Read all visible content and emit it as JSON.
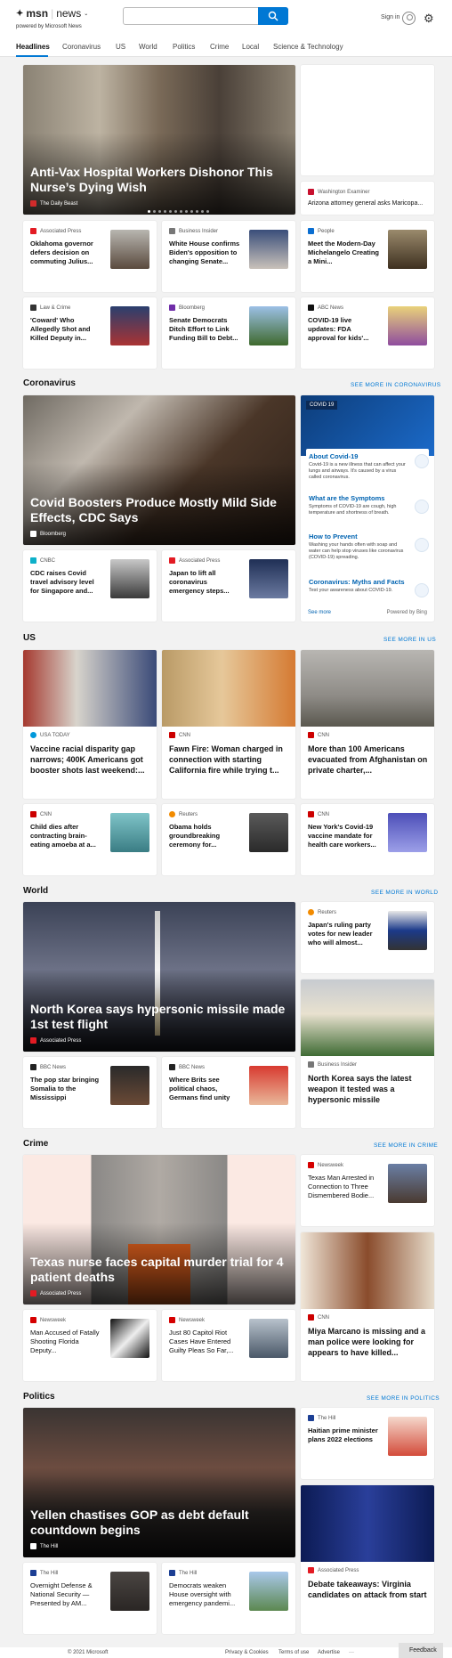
{
  "header": {
    "brand": "msn",
    "product": "news",
    "powered_by": "powered by Microsoft News",
    "search_placeholder": "",
    "sign_in": "Sign in"
  },
  "nav": [
    "Headlines",
    "Coronavirus",
    "US",
    "World",
    "Politics",
    "Crime",
    "Local",
    "Science & Technology"
  ],
  "headlines": {
    "hero": {
      "title": "Anti-Vax Hospital Workers Dishonor This Nurse’s Dying Wish",
      "source": "The Daily Beast"
    },
    "side": {
      "source": "Washington Examiner",
      "title": "Arizona attorney general asks Maricopa..."
    },
    "row1": [
      {
        "source": "Associated Press",
        "title": "Oklahoma governor defers decision on commuting Julius..."
      },
      {
        "source": "Business Insider",
        "title": "White House confirms Biden's opposition to changing Senate..."
      },
      {
        "source": "People",
        "title": "Meet the Modern-Day Michelangelo Creating a Mini..."
      }
    ],
    "row2": [
      {
        "source": "Law & Crime",
        "title": "'Coward' Who Allegedly Shot and Killed Deputy in..."
      },
      {
        "source": "Bloomberg",
        "title": "Senate Democrats Ditch Effort to Link Funding Bill to Debt..."
      },
      {
        "source": "ABC News",
        "title": "COVID-19 live updates: FDA approval for kids'..."
      }
    ]
  },
  "coronavirus": {
    "heading": "Coronavirus",
    "more": "SEE MORE IN CORONAVIRUS",
    "hero": {
      "title": "Covid Boosters Produce Mostly Mild Side Effects, CDC Says",
      "source": "Bloomberg"
    },
    "row": [
      {
        "source": "CNBC",
        "title": "CDC raises Covid travel advisory level for Singapore and..."
      },
      {
        "source": "Associated Press",
        "title": "Japan to lift all coronavirus emergency steps..."
      }
    ],
    "panel": {
      "tag": "COVID 19",
      "items": [
        {
          "h": "About Covid-19",
          "d": "Covid-19 is a new illness that can affect your lungs and airways. It's caused by a virus called coronavirus."
        },
        {
          "h": "What are the Symptoms",
          "d": "Symptoms of COVID-19 are cough, high temperature and shortness of breath."
        },
        {
          "h": "How to Prevent",
          "d": "Washing your hands often with soap and water can help stop viruses like coronavirus (COVID-19) spreading."
        },
        {
          "h": "Coronavirus: Myths and Facts",
          "d": "Test your awareness about COVID-19."
        }
      ],
      "see_more": "See more",
      "powered": "Powered by Bing"
    }
  },
  "us": {
    "heading": "US",
    "more": "SEE MORE IN US",
    "top": [
      {
        "source": "USA TODAY",
        "title": "Vaccine racial disparity gap narrows; 400K Americans got booster shots last weekend:..."
      },
      {
        "source": "CNN",
        "title": "Fawn Fire: Woman charged in connection with starting California fire while trying t..."
      },
      {
        "source": "CNN",
        "title": "More than 100 Americans evacuated from Afghanistan on private charter,..."
      }
    ],
    "row": [
      {
        "source": "CNN",
        "title": "Child dies after contracting brain-eating amoeba at a..."
      },
      {
        "source": "Reuters",
        "title": "Obama holds groundbreaking ceremony for..."
      },
      {
        "source": "CNN",
        "title": "New York's Covid-19 vaccine mandate for health care workers..."
      }
    ]
  },
  "world": {
    "heading": "World",
    "more": "SEE MORE IN WORLD",
    "hero": {
      "title": "North Korea says hypersonic missile made 1st test flight",
      "source": "Associated Press"
    },
    "side": {
      "source": "Reuters",
      "title": "Japan's ruling party votes for new leader who will almost..."
    },
    "row": [
      {
        "source": "BBC News",
        "title": "The pop star bringing Somalia to the Mississippi"
      },
      {
        "source": "BBC News",
        "title": "Where Brits see political chaos, Germans find unity"
      }
    ],
    "tall": {
      "source": "Business Insider",
      "title": "North Korea says the latest weapon it tested was a hypersonic missile"
    }
  },
  "crime": {
    "heading": "Crime",
    "more": "SEE MORE IN CRIME",
    "hero": {
      "title": "Texas nurse faces capital murder trial for 4 patient deaths",
      "source": "Associated Press"
    },
    "side": {
      "source": "Newsweek",
      "title": "Texas Man Arrested in Connection to Three Dismembered Bodie..."
    },
    "row": [
      {
        "source": "Newsweek",
        "title": "Man Accused of Fatally Shooting Florida Deputy..."
      },
      {
        "source": "Newsweek",
        "title": "Just 80 Capitol Riot Cases Have Entered Guilty Pleas So Far,..."
      }
    ],
    "tall": {
      "source": "CNN",
      "title": "Miya Marcano is missing and a man police were looking for appears to have killed..."
    }
  },
  "politics": {
    "heading": "Politics",
    "more": "SEE MORE IN POLITICS",
    "hero": {
      "title": "Yellen chastises GOP as debt default countdown begins",
      "source": "The Hill"
    },
    "side": {
      "source": "The Hill",
      "title": "Haitian prime minister plans 2022 elections"
    },
    "row": [
      {
        "source": "The Hill",
        "title": "Overnight Defense & National Security — Presented by AM..."
      },
      {
        "source": "The Hill",
        "title": "Democrats weaken House oversight with emergency pandemi..."
      }
    ],
    "tall": {
      "source": "Associated Press",
      "title": "Debate takeaways: Virginia candidates on attack from start"
    }
  },
  "footer": {
    "copyright": "© 2021 Microsoft",
    "privacy": "Privacy & Cookies",
    "terms": "Terms of use",
    "advertise": "Advertise",
    "feedback": "Feedback"
  }
}
